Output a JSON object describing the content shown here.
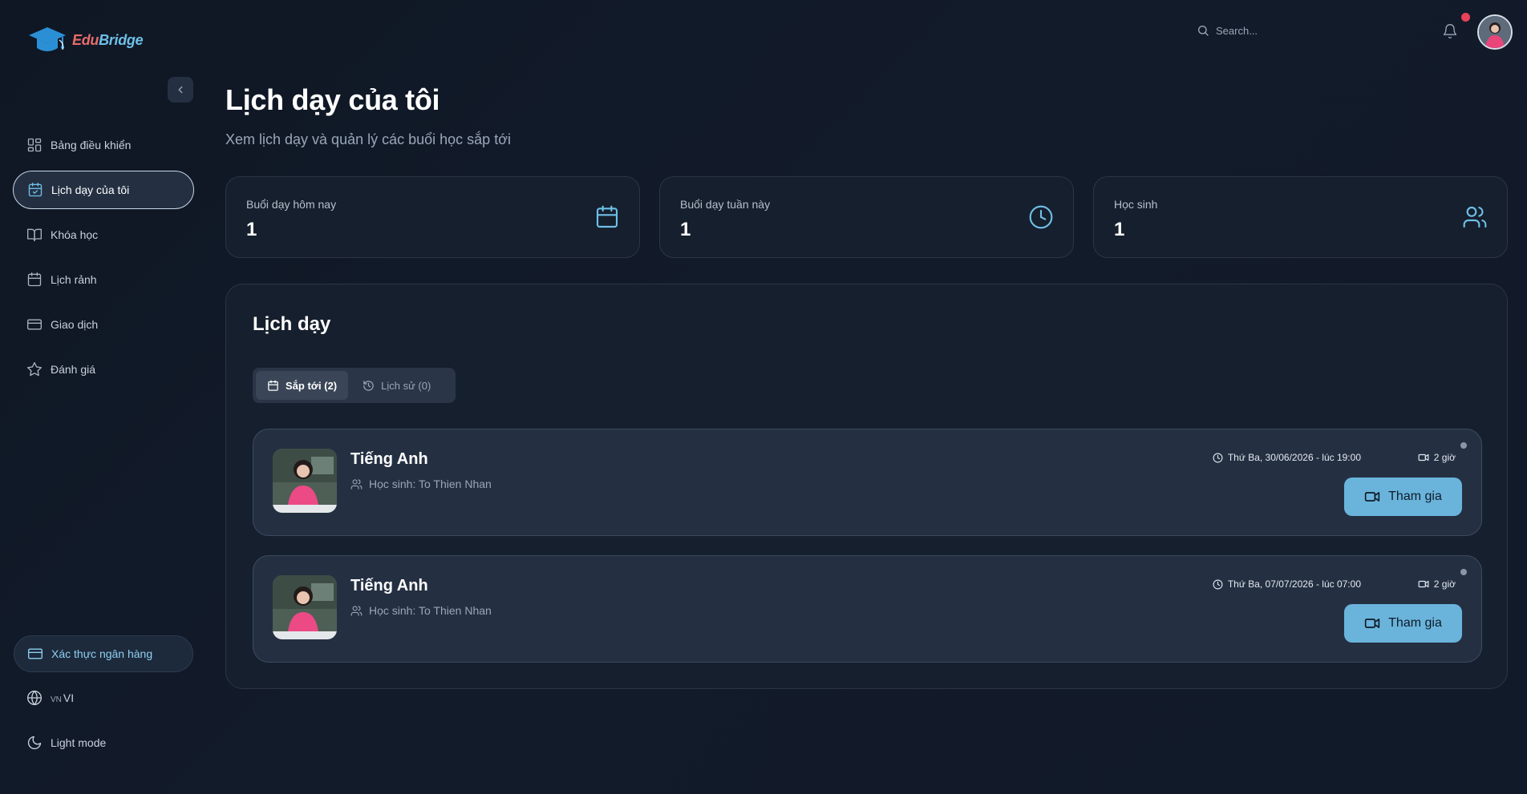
{
  "app": {
    "logo_edu": "Edu",
    "logo_bridge": "Bridge"
  },
  "sidebar": {
    "items": [
      {
        "label": "Bảng điều khiển",
        "icon": "dashboard-icon"
      },
      {
        "label": "Lịch dạy của tôi",
        "icon": "calendar-check-icon",
        "active": true
      },
      {
        "label": "Khóa học",
        "icon": "book-icon"
      },
      {
        "label": "Lịch rảnh",
        "icon": "calendar-icon"
      },
      {
        "label": "Giao dịch",
        "icon": "credit-card-icon"
      },
      {
        "label": "Đánh giá",
        "icon": "star-icon"
      }
    ],
    "bank_label": "Xác thực ngân hàng",
    "lang_flag": "VN",
    "lang_label": "VI",
    "mode_label": "Light mode"
  },
  "header": {
    "search_placeholder": "Search..."
  },
  "page": {
    "title": "Lịch dạy của tôi",
    "subtitle": "Xem lịch dạy và quản lý các buổi học sắp tới"
  },
  "stats": [
    {
      "label": "Buổi dạy hôm nay",
      "value": "1",
      "icon": "calendar-icon"
    },
    {
      "label": "Buổi dạy tuần này",
      "value": "1",
      "icon": "clock-icon"
    },
    {
      "label": "Học sinh",
      "value": "1",
      "icon": "users-icon"
    }
  ],
  "schedule": {
    "title": "Lịch dạy",
    "tabs": [
      {
        "label": "Sắp tới (2)",
        "icon": "calendar-icon",
        "active": true
      },
      {
        "label": "Lịch sử (0)",
        "icon": "history-icon"
      }
    ],
    "lessons": [
      {
        "course": "Tiếng Anh",
        "student": "Học sinh: To Thien Nhan",
        "time": "Thứ Ba, 30/06/2026 - lúc 19:00",
        "duration": "2 giờ",
        "join_label": "Tham gia"
      },
      {
        "course": "Tiếng Anh",
        "student": "Học sinh: To Thien Nhan",
        "time": "Thứ Ba, 07/07/2026 - lúc 07:00",
        "duration": "2 giờ",
        "join_label": "Tham gia"
      }
    ]
  },
  "colors": {
    "accent": "#6ec0e8",
    "button": "#6ab4dc",
    "notification": "#e8415a",
    "background": "#0f1724"
  }
}
